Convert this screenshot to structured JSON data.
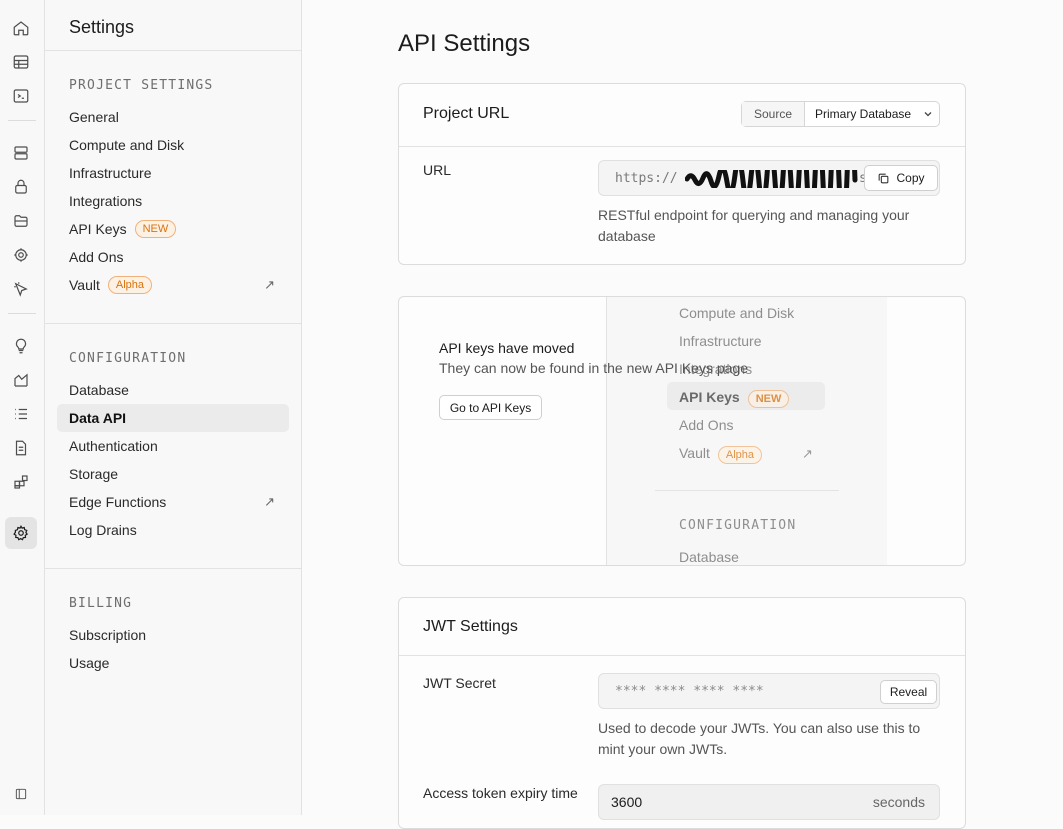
{
  "menu": {
    "title": "Settings",
    "sections": [
      {
        "title": "PROJECT SETTINGS",
        "items": [
          {
            "label": "General"
          },
          {
            "label": "Compute and Disk"
          },
          {
            "label": "Infrastructure"
          },
          {
            "label": "Integrations"
          },
          {
            "label": "API Keys",
            "badge": "NEW"
          },
          {
            "label": "Add Ons"
          },
          {
            "label": "Vault",
            "badge": "Alpha"
          }
        ]
      },
      {
        "title": "CONFIGURATION",
        "items": [
          {
            "label": "Database"
          },
          {
            "label": "Data API"
          },
          {
            "label": "Authentication"
          },
          {
            "label": "Storage"
          },
          {
            "label": "Edge Functions"
          },
          {
            "label": "Log Drains"
          }
        ]
      },
      {
        "title": "BILLING",
        "items": [
          {
            "label": "Subscription"
          },
          {
            "label": "Usage"
          }
        ]
      }
    ],
    "external_arrow": "↗"
  },
  "page": {
    "title": "API Settings"
  },
  "project_url": {
    "title": "Project URL",
    "source_label": "Source",
    "source_value": "Primary Database",
    "url_label": "URL",
    "url_value": "https://",
    "url_suffix": "s",
    "copy_label": "Copy",
    "help": "RESTful endpoint for querying and managing your database"
  },
  "moved": {
    "title": "API keys have moved",
    "text": "They can now be found in the new API Keys page",
    "button": "Go to API Keys",
    "preview": {
      "items": [
        "Compute and Disk",
        "Infrastructure",
        "Integrations",
        "API Keys",
        "Add Ons",
        "Vault"
      ],
      "api_badge": "NEW",
      "vault_badge": "Alpha",
      "section": "CONFIGURATION",
      "section_item": "Database"
    }
  },
  "jwt": {
    "title": "JWT Settings",
    "secret_label": "JWT Secret",
    "secret_value": "**** **** **** ****",
    "reveal_label": "Reveal",
    "secret_help": "Used to decode your JWTs. You can also use this to mint your own JWTs.",
    "expiry_label": "Access token expiry time",
    "expiry_value": "3600",
    "expiry_unit": "seconds"
  }
}
